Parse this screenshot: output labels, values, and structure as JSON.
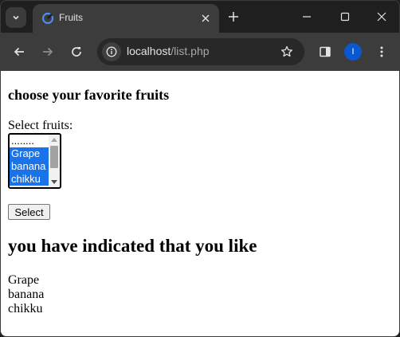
{
  "browser": {
    "tab_title": "Fruits",
    "url_host": "localhost",
    "url_path": "/list.php",
    "profile_initial": "I",
    "accent": "#0b57d0"
  },
  "page": {
    "heading": "choose your favorite fruits",
    "select_label": "Select fruits:",
    "options": [
      {
        "label": "........",
        "selected": false
      },
      {
        "label": "Grape",
        "selected": true
      },
      {
        "label": "banana",
        "selected": true
      },
      {
        "label": "chikku",
        "selected": true
      }
    ],
    "button_label": "Select",
    "result_heading": "you have indicated that you like",
    "results": [
      "Grape",
      "banana",
      "chikku"
    ]
  }
}
